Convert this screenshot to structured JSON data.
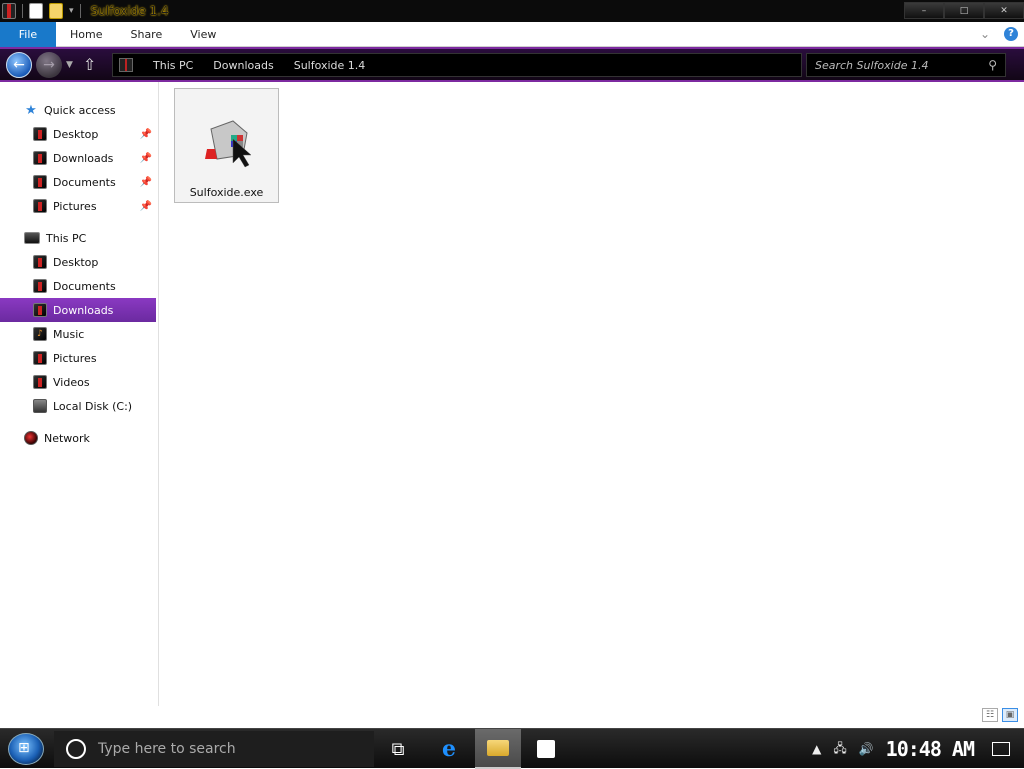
{
  "window": {
    "title": "Sulfoxide 1.4",
    "controls": {
      "minimize": "–",
      "maximize": "□",
      "close": "✕"
    }
  },
  "ribbon": {
    "tabs": [
      {
        "label": "File"
      },
      {
        "label": "Home"
      },
      {
        "label": "Share"
      },
      {
        "label": "View"
      }
    ],
    "expand_icon": "chevron-down-icon",
    "help_icon": "help-icon"
  },
  "address": {
    "crumbs": [
      "This PC",
      "Downloads",
      "Sulfoxide 1.4"
    ]
  },
  "search": {
    "placeholder": "Search Sulfoxide 1.4"
  },
  "sidebar": {
    "quick_access": {
      "label": "Quick access",
      "items": [
        {
          "label": "Desktop",
          "pinned": true
        },
        {
          "label": "Downloads",
          "pinned": true
        },
        {
          "label": "Documents",
          "pinned": true
        },
        {
          "label": "Pictures",
          "pinned": true
        }
      ]
    },
    "this_pc": {
      "label": "This PC",
      "items": [
        {
          "label": "Desktop"
        },
        {
          "label": "Documents"
        },
        {
          "label": "Downloads",
          "selected": true
        },
        {
          "label": "Music"
        },
        {
          "label": "Pictures"
        },
        {
          "label": "Videos"
        },
        {
          "label": "Local Disk (C:)"
        }
      ]
    },
    "network": {
      "label": "Network"
    }
  },
  "files": [
    {
      "name": "Sulfoxide.exe",
      "icon": "application-icon"
    }
  ],
  "taskbar": {
    "search_placeholder": "Type here to search",
    "clock": "10:48 AM",
    "pinned": [
      "task-view-icon",
      "edge-icon",
      "file-explorer-icon",
      "store-icon"
    ],
    "tray": [
      "chevron-up-icon",
      "network-icon",
      "volume-icon",
      "notification-icon"
    ]
  },
  "colors": {
    "accent_purple": "#7d2aa0",
    "file_tab_blue": "#1979ca",
    "selection_purple": "#8a39c2"
  }
}
